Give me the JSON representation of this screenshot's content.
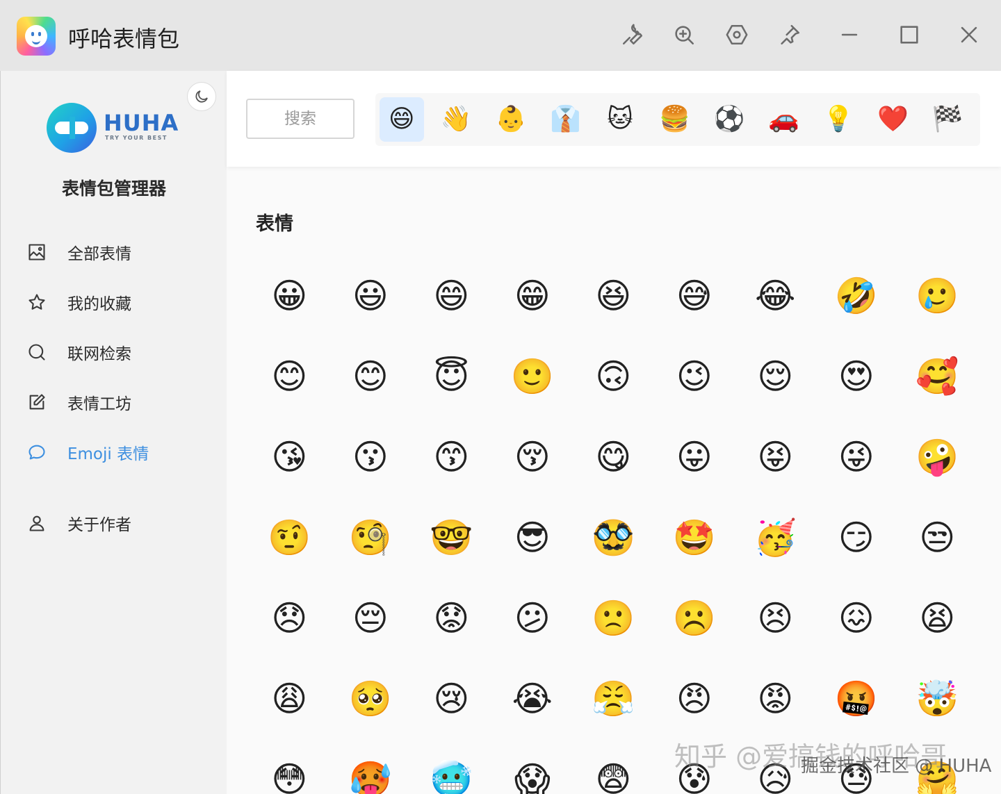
{
  "window": {
    "title": "呼哈表情包"
  },
  "sidebar": {
    "brand": "HUHA",
    "brand_tagline": "TRY YOUR BEST",
    "title": "表情包管理器",
    "items": [
      {
        "label": "全部表情",
        "icon": "image-icon"
      },
      {
        "label": "我的收藏",
        "icon": "star-icon"
      },
      {
        "label": "联网检索",
        "icon": "search-icon"
      },
      {
        "label": "表情工坊",
        "icon": "edit-icon"
      },
      {
        "label": "Emoji 表情",
        "icon": "chat-bubble-icon",
        "active": true
      },
      {
        "label": "关于作者",
        "icon": "user-icon"
      }
    ]
  },
  "search": {
    "placeholder": "搜索"
  },
  "categories": [
    "😄",
    "👋",
    "👶",
    "👔",
    "🐱",
    "🍔",
    "⚽",
    "🚗",
    "💡",
    "❤️",
    "🏁"
  ],
  "section": {
    "title": "表情"
  },
  "emojis": [
    "😀",
    "😃",
    "😄",
    "😁",
    "😆",
    "😅",
    "😂",
    "🤣",
    "🥲",
    "😊",
    "😊",
    "😇",
    "🙂",
    "🙃",
    "😉",
    "😌",
    "😍",
    "🥰",
    "😘",
    "😗",
    "😙",
    "😚",
    "😋",
    "😛",
    "😝",
    "😜",
    "🤪",
    "🤨",
    "🧐",
    "🤓",
    "😎",
    "🥸",
    "🤩",
    "🥳",
    "😏",
    "😒",
    "😞",
    "😔",
    "😟",
    "😕",
    "🙁",
    "☹️",
    "😣",
    "😖",
    "😫",
    "😩",
    "🥺",
    "😢",
    "😭",
    "😤",
    "😠",
    "😡",
    "🤬",
    "🤯",
    "😳",
    "🥵",
    "🥶",
    "😱",
    "😨",
    "😰",
    "😥",
    "😓",
    "🤗"
  ],
  "watermark": {
    "line1": "知乎 @爱搞钱的呼哈哥",
    "line2": "掘金技术社区 @ HUHA"
  },
  "colors": {
    "accent": "#3d8fe0",
    "selected_tab_bg": "#dcecff"
  }
}
